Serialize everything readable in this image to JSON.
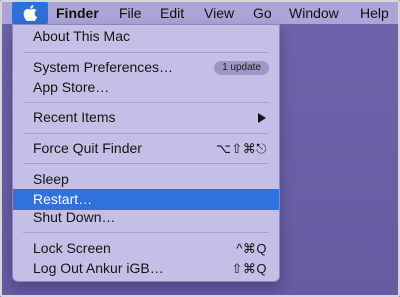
{
  "menubar": {
    "apple_icon": "apple-icon",
    "items": [
      "Finder",
      "File",
      "Edit",
      "View",
      "Go",
      "Window",
      "Help"
    ]
  },
  "apple_menu": {
    "items": [
      {
        "label": "About This Mac"
      },
      {
        "label": "System Preferences…",
        "badge": "1 update"
      },
      {
        "label": "App Store…"
      },
      {
        "label": "Recent Items",
        "submenu_icon": "triangle-right-icon"
      },
      {
        "label": "Force Quit Finder",
        "shortcut": "⌥⇧⌘⎋"
      },
      {
        "label": "Sleep"
      },
      {
        "label": "Restart…"
      },
      {
        "label": "Shut Down…"
      },
      {
        "label": "Lock Screen",
        "shortcut": "^⌘Q"
      },
      {
        "label": "Log Out Ankur iGB…",
        "shortcut": "⇧⌘Q"
      }
    ],
    "highlighted": "Restart…"
  },
  "colors": {
    "menubar_bg": "#ada5d8",
    "menu_bg": "#c4bfe6",
    "highlight": "#2f72dd",
    "desktop": "#6a5fa3"
  }
}
